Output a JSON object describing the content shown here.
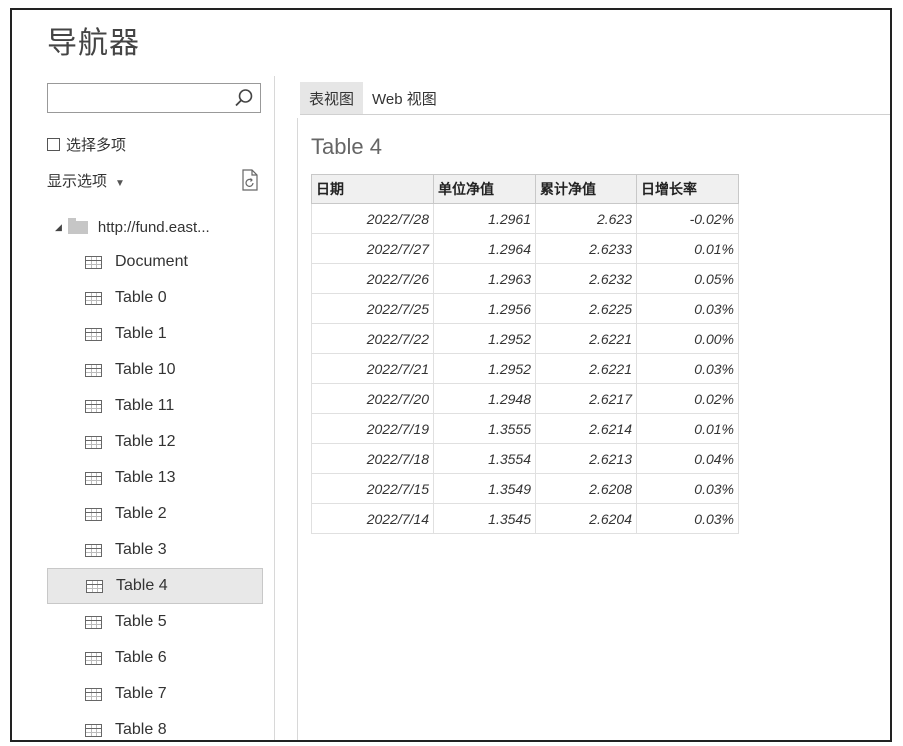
{
  "title": "导航器",
  "search": {
    "value": "",
    "placeholder": ""
  },
  "multi_select_label": "选择多项",
  "display_options_label": "显示选项",
  "tree": {
    "root_label": "http://fund.east...",
    "items": [
      {
        "label": "Document",
        "selected": false
      },
      {
        "label": "Table 0",
        "selected": false
      },
      {
        "label": "Table 1",
        "selected": false
      },
      {
        "label": "Table 10",
        "selected": false
      },
      {
        "label": "Table 11",
        "selected": false
      },
      {
        "label": "Table 12",
        "selected": false
      },
      {
        "label": "Table 13",
        "selected": false
      },
      {
        "label": "Table 2",
        "selected": false
      },
      {
        "label": "Table 3",
        "selected": false
      },
      {
        "label": "Table 4",
        "selected": true
      },
      {
        "label": "Table 5",
        "selected": false
      },
      {
        "label": "Table 6",
        "selected": false
      },
      {
        "label": "Table 7",
        "selected": false
      },
      {
        "label": "Table 8",
        "selected": false
      }
    ]
  },
  "tabs": [
    {
      "label": "表视图",
      "active": true
    },
    {
      "label": "Web 视图",
      "active": false
    }
  ],
  "preview": {
    "table_name": "Table 4",
    "columns": [
      "日期",
      "单位净值",
      "累计净值",
      "日增长率"
    ],
    "rows": [
      [
        "2022/7/28",
        "1.2961",
        "2.623",
        "-0.02%"
      ],
      [
        "2022/7/27",
        "1.2964",
        "2.6233",
        "0.01%"
      ],
      [
        "2022/7/26",
        "1.2963",
        "2.6232",
        "0.05%"
      ],
      [
        "2022/7/25",
        "1.2956",
        "2.6225",
        "0.03%"
      ],
      [
        "2022/7/22",
        "1.2952",
        "2.6221",
        "0.00%"
      ],
      [
        "2022/7/21",
        "1.2952",
        "2.6221",
        "0.03%"
      ],
      [
        "2022/7/20",
        "1.2948",
        "2.6217",
        "0.02%"
      ],
      [
        "2022/7/19",
        "1.3555",
        "2.6214",
        "0.01%"
      ],
      [
        "2022/7/18",
        "1.3554",
        "2.6213",
        "0.04%"
      ],
      [
        "2022/7/15",
        "1.3549",
        "2.6208",
        "0.03%"
      ],
      [
        "2022/7/14",
        "1.3545",
        "2.6204",
        "0.03%"
      ]
    ]
  }
}
